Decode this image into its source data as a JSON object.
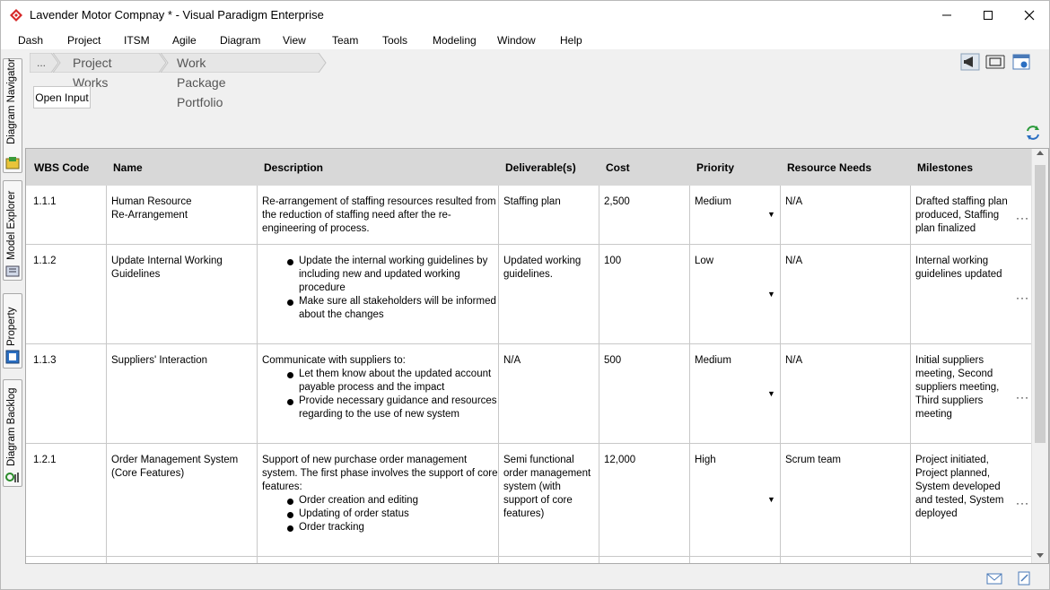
{
  "window": {
    "title": "Lavender Motor Compnay * - Visual Paradigm Enterprise"
  },
  "menu": [
    "Dash",
    "Project",
    "ITSM",
    "Agile",
    "Diagram",
    "View",
    "Team",
    "Tools",
    "Modeling",
    "Window",
    "Help"
  ],
  "side_tabs": [
    "Diagram Navigator",
    "Model Explorer",
    "Property",
    "Diagram Backlog"
  ],
  "breadcrumb": [
    "...",
    "Project Works",
    "Work Package Portfolio"
  ],
  "toolbar": {
    "open_input_label": "Open Input"
  },
  "table": {
    "columns": [
      "WBS Code",
      "Name",
      "Description",
      "Deliverable(s)",
      "Cost",
      "Priority",
      "Resource Needs",
      "Milestones"
    ],
    "rows": [
      {
        "wbs": "1.1.1",
        "name": [
          "Human Resource",
          "Re-Arrangement"
        ],
        "desc_text": [
          "Re-arrangement of staffing resources resulted from",
          "the reduction of staffing need after the re-",
          "engineering of process."
        ],
        "desc_bullets": [],
        "deliverable": [
          "Staffing plan"
        ],
        "cost": "2,500",
        "priority": "Medium",
        "resource": "N/A",
        "milestones": [
          "Drafted staffing plan",
          "produced, Staffing",
          "plan finalized"
        ]
      },
      {
        "wbs": "1.1.2",
        "name": [
          "Update Internal Working",
          "Guidelines"
        ],
        "desc_text": [],
        "desc_bullets": [
          [
            "Update the internal working guidelines by",
            "including new and updated working",
            "procedure"
          ],
          [
            "Make sure all stakeholders will be informed",
            "about the changes"
          ]
        ],
        "deliverable": [
          "Updated working",
          "guidelines."
        ],
        "cost": "100",
        "priority": "Low",
        "resource": "N/A",
        "milestones": [
          "Internal working",
          "guidelines updated"
        ]
      },
      {
        "wbs": "1.1.3",
        "name": [
          "Suppliers' Interaction"
        ],
        "desc_text": [
          "Communicate with suppliers to:"
        ],
        "desc_bullets": [
          [
            "Let them know about the updated account",
            "payable process and the impact"
          ],
          [
            "Provide necessary guidance and resources",
            "regarding to the use of new system"
          ]
        ],
        "deliverable": [
          "N/A"
        ],
        "cost": "500",
        "priority": "Medium",
        "resource": "N/A",
        "milestones": [
          "Initial suppliers",
          "meeting, Second",
          "suppliers meeting,",
          "Third suppliers",
          "meeting"
        ]
      },
      {
        "wbs": "1.2.1",
        "name": [
          "Order Management System",
          "(Core Features)"
        ],
        "desc_text": [
          "Support of new purchase order management",
          "system. The first phase involves the support of core",
          "features:"
        ],
        "desc_bullets": [
          [
            "Order creation and editing"
          ],
          [
            "Updating of order status"
          ],
          [
            "Order tracking"
          ]
        ],
        "deliverable": [
          "Semi functional",
          "order management",
          "system (with",
          "support of core",
          "features)"
        ],
        "cost": "12,000",
        "priority": "High",
        "resource": "Scrum team",
        "milestones": [
          "Project initiated,",
          "Project planned,",
          "System developed",
          "and tested, System",
          "deployed"
        ]
      }
    ]
  },
  "colors": {
    "header_bg": "#d8d8d8",
    "grid_line": "#c8c8c8",
    "window_bg": "#f0f0f0"
  },
  "icons": [
    "app-logo-icon",
    "minimize-icon",
    "maximize-icon",
    "close-icon",
    "megaphone-icon",
    "fit-width-icon",
    "panel-settings-icon",
    "refresh-icon",
    "mail-icon",
    "note-icon"
  ]
}
